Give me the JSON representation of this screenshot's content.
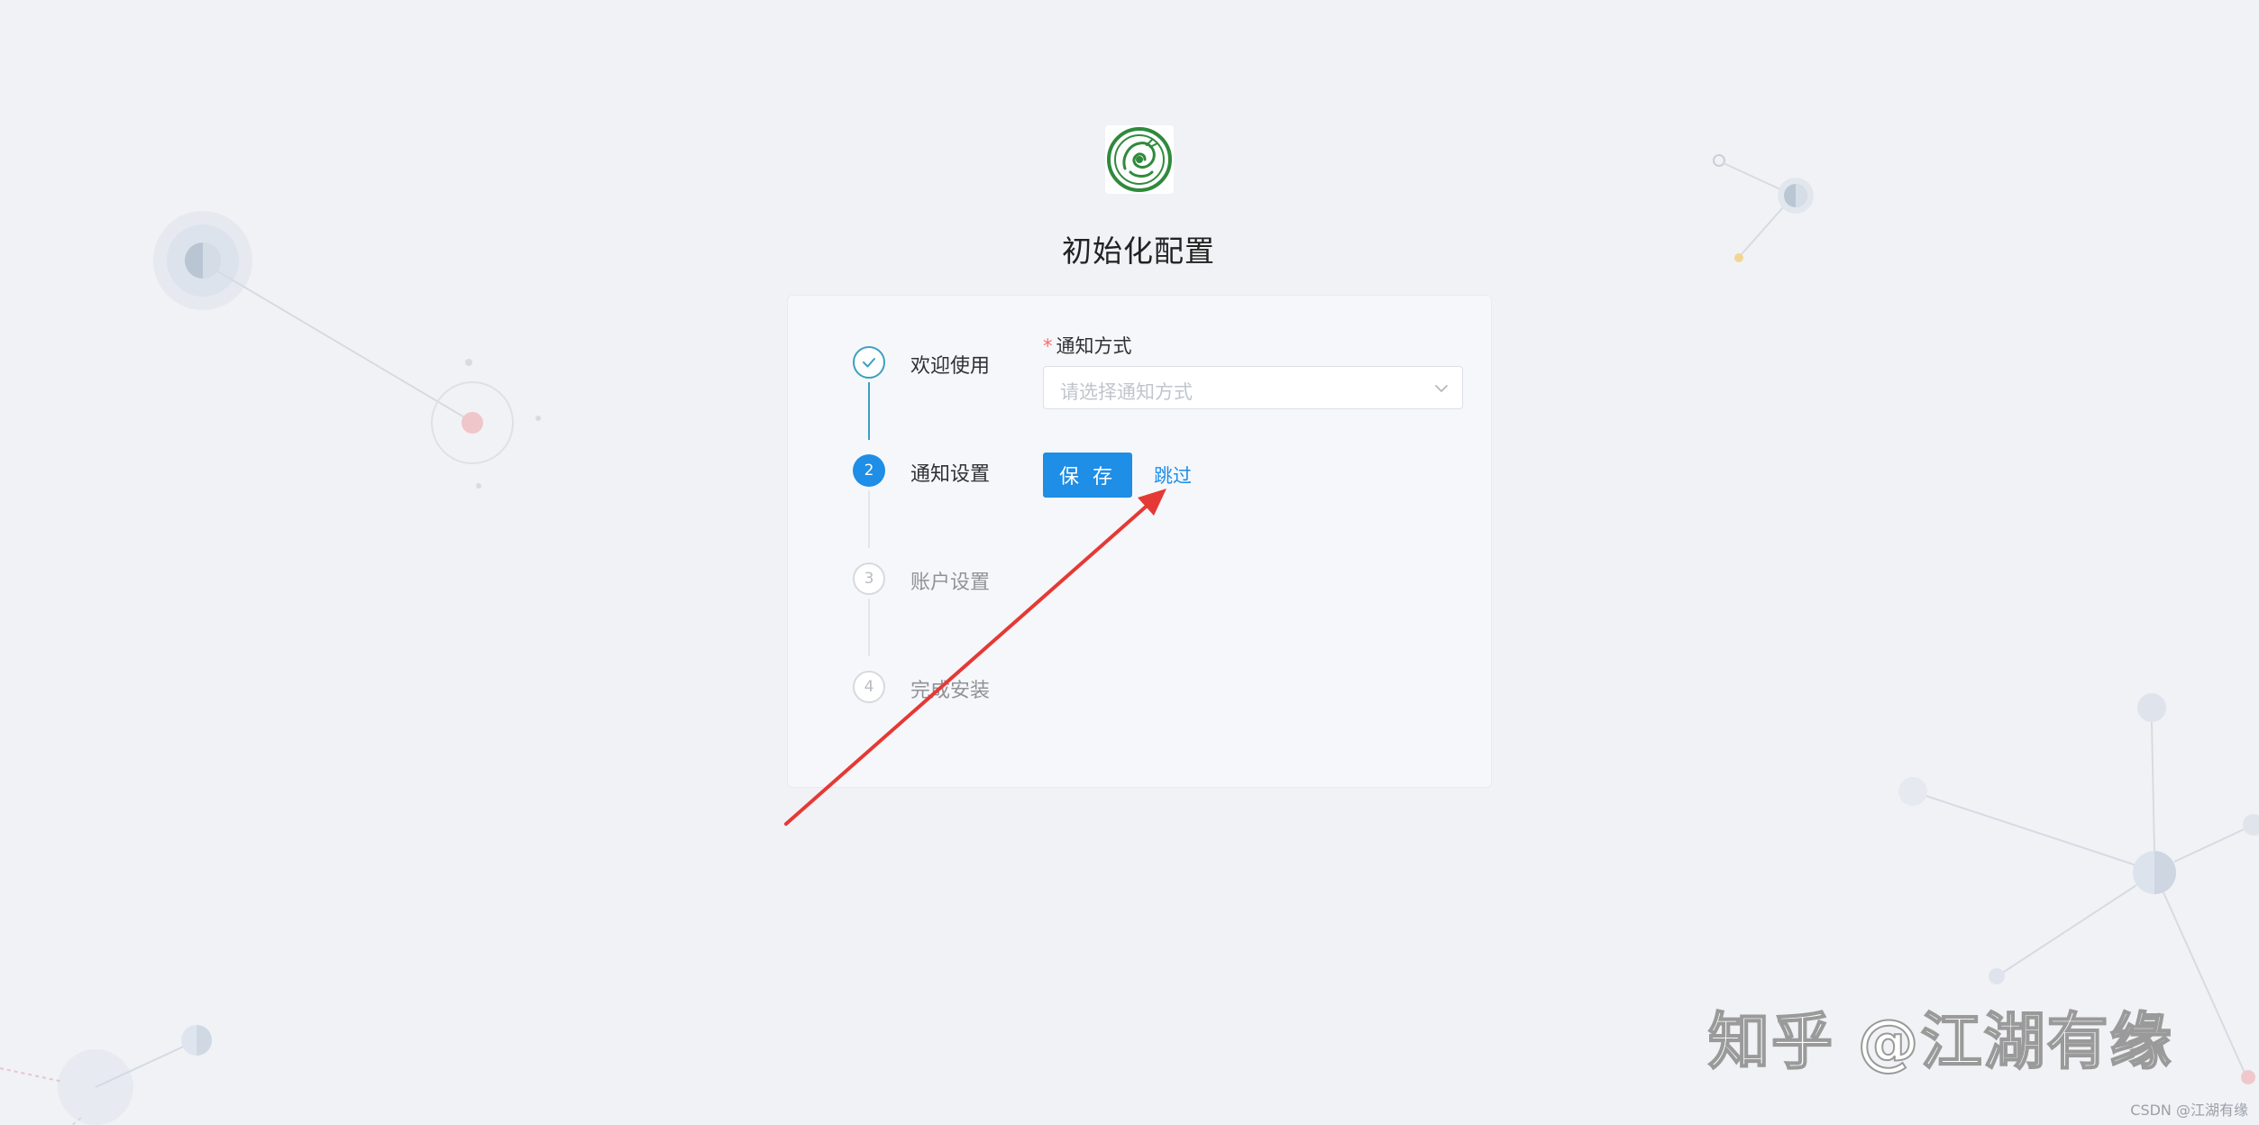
{
  "page": {
    "title": "初始化配置"
  },
  "logo": {
    "icon": "dragon-emblem-icon",
    "color": "#2f8a3c"
  },
  "steps": [
    {
      "number": "✓",
      "label": "欢迎使用",
      "status": "done"
    },
    {
      "number": "2",
      "label": "通知设置",
      "status": "active"
    },
    {
      "number": "3",
      "label": "账户设置",
      "status": "todo"
    },
    {
      "number": "4",
      "label": "完成安装",
      "status": "todo"
    }
  ],
  "form": {
    "required_mark": "*",
    "field_label": "通知方式",
    "select_placeholder": "请选择通知方式",
    "save_label": "保 存",
    "skip_label": "跳过"
  },
  "watermarks": {
    "zhihu": "知乎 @江湖有缘",
    "csdn": "CSDN @江湖有缘"
  },
  "colors": {
    "primary": "#1e8ee6",
    "done": "#3aa0c2",
    "required": "#f56c6c",
    "annotation_arrow": "#e53935"
  }
}
